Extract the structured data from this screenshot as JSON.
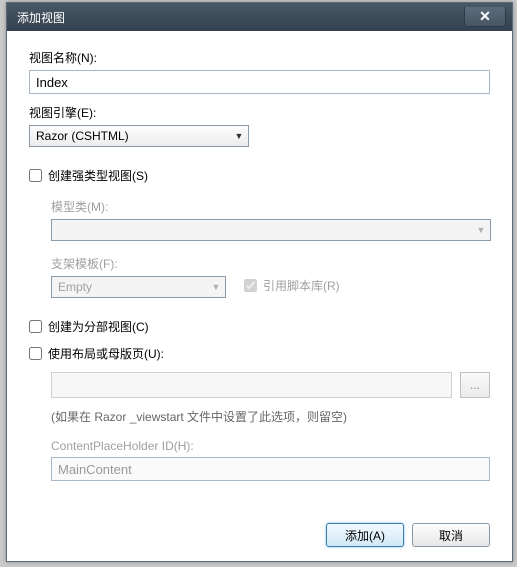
{
  "window": {
    "title": "添加视图"
  },
  "fields": {
    "view_name": {
      "label": "视图名称(N):",
      "value": "Index"
    },
    "view_engine": {
      "label": "视图引擎(E):",
      "value": "Razor (CSHTML)"
    }
  },
  "strongly_typed": {
    "label": "创建强类型视图(S)",
    "checked": false,
    "model_class": {
      "label": "模型类(M):",
      "value": ""
    },
    "scaffold": {
      "label": "支架模板(F):",
      "value": "Empty"
    },
    "ref_script_lib": {
      "label": "引用脚本库(R)",
      "checked": true
    }
  },
  "partial": {
    "label": "创建为分部视图(C)",
    "checked": false
  },
  "layout": {
    "label": "使用布局或母版页(U):",
    "checked": false,
    "path": "",
    "hint": "(如果在 Razor _viewstart 文件中设置了此选项，则留空)",
    "cph": {
      "label": "ContentPlaceHolder ID(H):",
      "value": "MainContent"
    }
  },
  "buttons": {
    "add": "添加(A)",
    "cancel": "取消"
  },
  "browse_label": "..."
}
